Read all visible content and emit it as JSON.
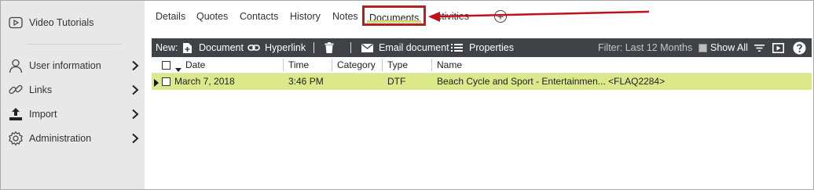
{
  "sidebar": {
    "top_item": {
      "label": "Video Tutorials",
      "icon": "play-icon"
    },
    "items": [
      {
        "label": "User information",
        "icon": "user-icon"
      },
      {
        "label": "Links",
        "icon": "link-icon"
      },
      {
        "label": "Import",
        "icon": "upload-icon"
      },
      {
        "label": "Administration",
        "icon": "gear-icon"
      }
    ]
  },
  "tabs": [
    {
      "label": "Details"
    },
    {
      "label": "Quotes"
    },
    {
      "label": "Contacts"
    },
    {
      "label": "History"
    },
    {
      "label": "Notes"
    },
    {
      "label": "Documents",
      "active": true
    },
    {
      "label": "ctivities"
    }
  ],
  "toolbar": {
    "new_label": "New:",
    "document_label": "Document",
    "hyperlink_label": "Hyperlink",
    "email_label": "Email document",
    "properties_label": "Properties",
    "filter_label": "Filter: Last 12 Months",
    "show_all_label": "Show All"
  },
  "grid": {
    "columns": [
      "Date",
      "Time",
      "Category",
      "Type",
      "Name"
    ],
    "rows": [
      {
        "date": "March 7, 2018",
        "time": "3:46 PM",
        "category": "",
        "type": "DTF",
        "name": "Beach Cycle and Sport - Entertainmen... <FLAQ2284>"
      }
    ]
  },
  "colors": {
    "selected_row": "#dbe98a",
    "toolbar": "#3f4246",
    "highlight_border": "#b22222",
    "annotation_arrow": "#c0101c"
  }
}
